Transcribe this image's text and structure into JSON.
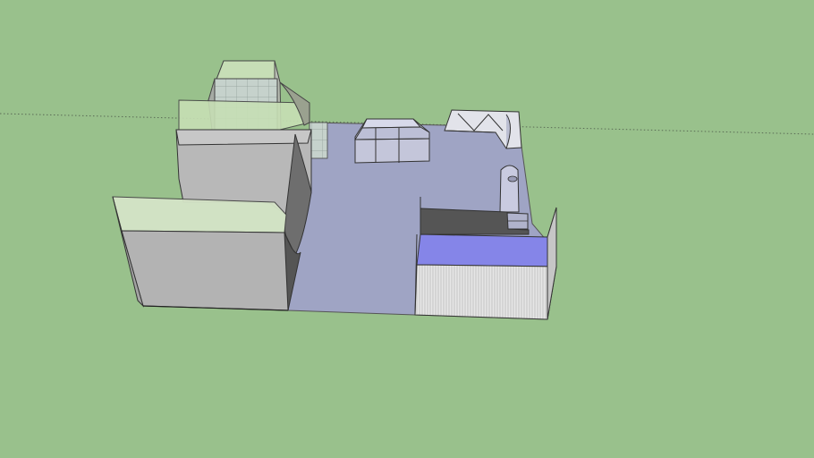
{
  "viewport": {
    "type": "3d-modeling-canvas",
    "background_color": "#99c18c",
    "horizon_line": "dotted"
  },
  "model": {
    "name": "",
    "parts": [
      {
        "id": "half-pipe-ramp",
        "color": "#b3b3b3"
      },
      {
        "id": "platform-block",
        "color": "#b8b8b8"
      },
      {
        "id": "stair-box",
        "color": "#c4c6da"
      },
      {
        "id": "pyramid-funbox",
        "color": "#bfc2e0"
      },
      {
        "id": "quarter-pipe-corner",
        "color": "#c8cade"
      },
      {
        "id": "grind-rail",
        "color": "#b0b3cc"
      },
      {
        "id": "fenced-building",
        "color": "#e0e0e0"
      }
    ],
    "floor_color": "#9fa4c4",
    "glass_color": "#cfe6bf",
    "accent_color": "#8585e8"
  }
}
